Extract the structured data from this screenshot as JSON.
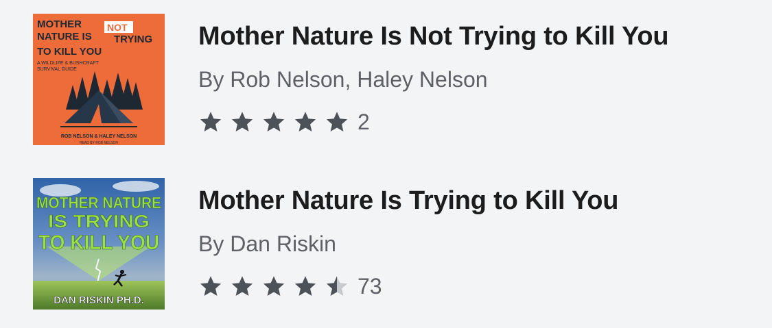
{
  "results": [
    {
      "title": "Mother Nature Is Not Trying to Kill You",
      "authors": "By Rob Nelson, Haley Nelson",
      "rating": 5,
      "rating_count": "2",
      "cover": {
        "line1": "MOTHER",
        "line2a": "NATURE IS",
        "line2_not": "NOT",
        "line2b": "TRYING",
        "line3": "TO KILL YOU",
        "subtitle1": "A WILDLIFE & BUSHCRAFT",
        "subtitle2": "SURVIVAL GUIDE",
        "byline": "ROB NELSON & HALEY NELSON",
        "narrator": "READ BY ROB NELSON",
        "bg_color": "#ee6b3a"
      }
    },
    {
      "title": "Mother Nature Is Trying to Kill You",
      "authors": "By Dan Riskin",
      "rating": 4.5,
      "rating_count": "73",
      "cover": {
        "line1": "MOTHER NATURE",
        "line2": "IS TRYING",
        "line3": "TO KILL YOU",
        "author": "DAN RISKIN PH.D.",
        "accent_color": "#9be04a"
      }
    }
  ],
  "colors": {
    "star_filled": "#4c5258",
    "star_empty": "#c7cacd",
    "title": "#1c1c1c",
    "meta": "#5d6166"
  }
}
